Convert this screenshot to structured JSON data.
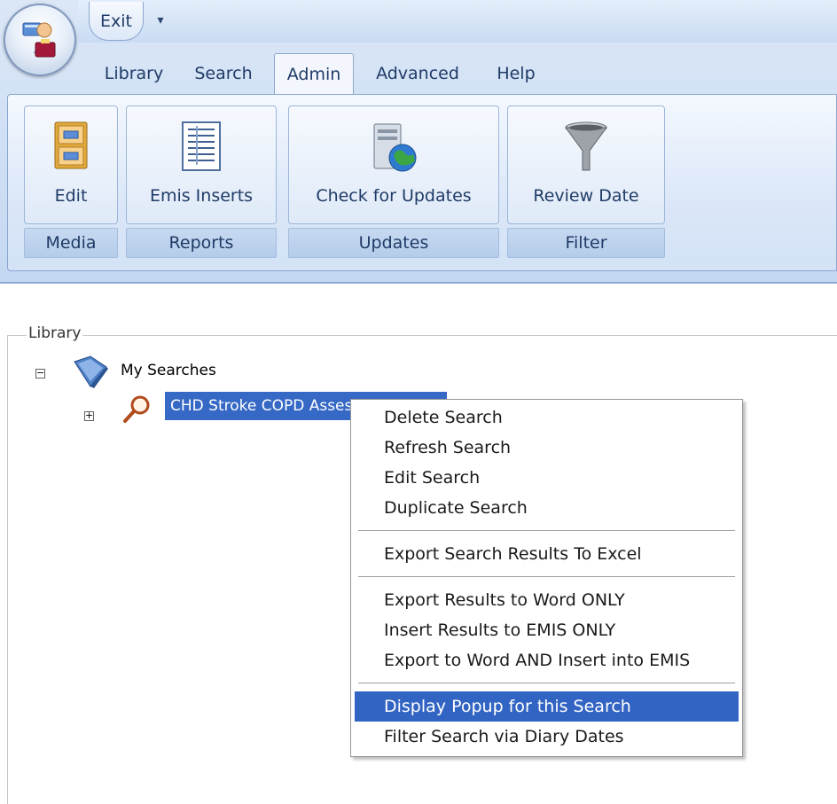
{
  "quick_access": {
    "exit_label": "Exit",
    "dropdown_glyph": "▾"
  },
  "tabs": [
    {
      "label": "Library",
      "active": false
    },
    {
      "label": "Search",
      "active": false
    },
    {
      "label": "Admin",
      "active": true
    },
    {
      "label": "Advanced",
      "active": false
    },
    {
      "label": "Help",
      "active": false
    }
  ],
  "ribbon": {
    "groups": [
      {
        "button_label": "Edit",
        "group_label": "Media",
        "icon": "filing-cabinet-icon"
      },
      {
        "button_label": "Emis Inserts",
        "group_label": "Reports",
        "icon": "document-list-icon"
      },
      {
        "button_label": "Check for Updates",
        "group_label": "Updates",
        "icon": "server-globe-icon"
      },
      {
        "button_label": "Review Date",
        "group_label": "Filter",
        "icon": "funnel-icon"
      }
    ]
  },
  "library": {
    "legend": "Library",
    "root": {
      "label": "My Searches",
      "expander": "−",
      "icon": "book-icon"
    },
    "child": {
      "label": "CHD Stroke COPD Assessment",
      "expander": "+",
      "icon": "magnifier-icon"
    }
  },
  "context_menu": {
    "items": [
      "Delete Search",
      "Refresh Search",
      "Edit Search",
      "Duplicate Search",
      "Export Search Results To Excel",
      "Export Results to Word ONLY",
      "Insert Results to EMIS ONLY",
      "Export to Word AND Insert into EMIS",
      "Display Popup for this Search",
      "Filter Search via Diary Dates"
    ],
    "highlighted": "Display Popup for this Search"
  },
  "colors": {
    "selection": "#3668c5",
    "menu_highlight": "#3264c3",
    "ribbon_text": "#1f3b66"
  }
}
